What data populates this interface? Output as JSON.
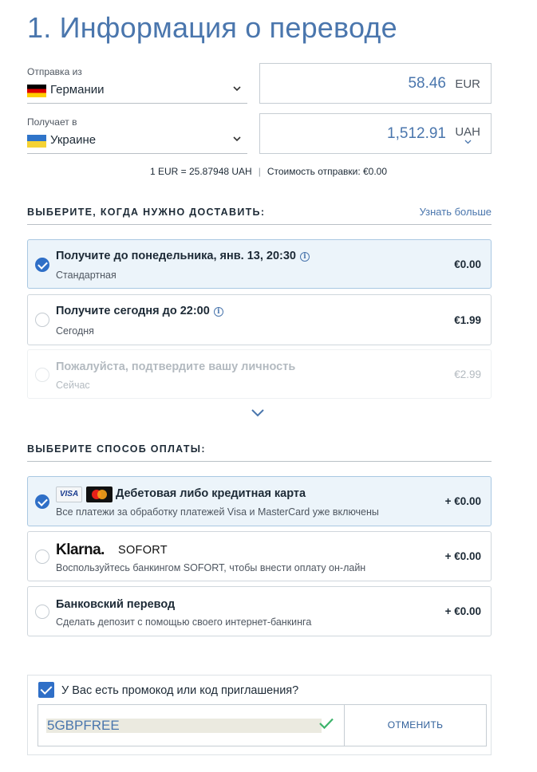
{
  "page": {
    "title": "1. Информация о переводе"
  },
  "transfer": {
    "send": {
      "label": "Отправка из",
      "country": "Германии",
      "flag": "flag-de",
      "amount": "58.46",
      "currency": "EUR"
    },
    "receive": {
      "label": "Получает в",
      "country": "Украине",
      "flag": "flag-ua",
      "amount": "1,512.91",
      "currency": "UAH"
    },
    "rate": "1 EUR = 25.87948 UAH",
    "separator": "|",
    "fee": "Стоимость отправки: €0.00"
  },
  "delivery": {
    "heading": "ВЫБЕРИТЕ, КОГДА НУЖНО ДОСТАВИТЬ:",
    "learn_more": "Узнать больше",
    "options": [
      {
        "title": "Получите до понедельника, янв. 13, 20:30",
        "subtitle": "Стандартная",
        "price": "€0.00",
        "state": "selected",
        "info": true
      },
      {
        "title": "Получите сегодня до 22:00",
        "subtitle": "Сегодня",
        "price": "€1.99",
        "state": "default",
        "info": true
      },
      {
        "title": "Пожалуйста, подтвердите вашу личность",
        "subtitle": "Сейчас",
        "price": "€2.99",
        "state": "disabled",
        "info": false
      }
    ]
  },
  "payment": {
    "heading": "ВЫБЕРИТЕ СПОСОБ ОПЛАТЫ:",
    "options": [
      {
        "title": "Дебетовая либо кредитная карта",
        "subtitle": "Все платежи за обработку платежей Visa и MasterCard уже включены",
        "price": "+ €0.00",
        "state": "selected",
        "logos": [
          "visa",
          "mastercard"
        ]
      },
      {
        "title": "SOFORT",
        "subtitle": "Воспользуйтесь банкингом SOFORT, чтобы внести оплату он-лайн",
        "price": "+ €0.00",
        "state": "default",
        "logos": [
          "klarna"
        ]
      },
      {
        "title": "Банковский перевод",
        "subtitle": "Сделать депозит с помощью своего интернет-банкинга",
        "price": "+ €0.00",
        "state": "default",
        "logos": []
      }
    ],
    "visa_text": "VISA",
    "klarna_text": "Klarna."
  },
  "promo": {
    "label": "У Вас есть промокод или код приглашения?",
    "checked": true,
    "code": "5GBPFREE",
    "cancel": "ОТМЕНИТЬ"
  },
  "colors": {
    "accent": "#4a76ad",
    "selected_bg": "#ecf4fa",
    "check_blue": "#2f6fc7",
    "success_green": "#3db36b"
  },
  "icons": {
    "country_chevron": "chevron-down-icon",
    "info": "info-icon",
    "expand": "chevron-down-icon",
    "promo_valid": "check-icon"
  }
}
